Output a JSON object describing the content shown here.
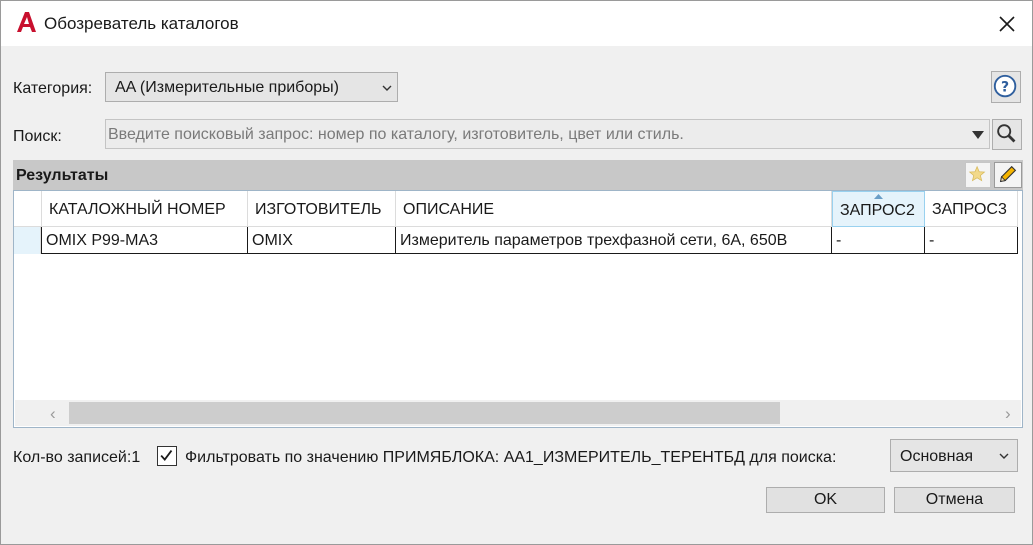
{
  "window": {
    "title": "Обозреватель каталогов",
    "icon": "autocad-logo-icon",
    "close_icon": "close-icon"
  },
  "category": {
    "label": "Категория:",
    "value": "AA (Измерительные приборы)"
  },
  "search": {
    "label": "Поиск:",
    "placeholder": "Введите поисковый запрос: номер по каталогу, изготовитель, цвет или стиль."
  },
  "results": {
    "title": "Результаты",
    "columns": [
      "КАТАЛОЖНЫЙ НОМЕР",
      "ИЗГОТОВИТЕЛЬ",
      "ОПИСАНИЕ",
      "ЗАПРОС2",
      "ЗАПРОС3"
    ],
    "rows": [
      [
        "OMIX P99-MA3",
        "OMIX",
        "Измеритель параметров трехфазной сети, 6А, 650В",
        "-",
        "-"
      ]
    ],
    "sorted_column": "ЗАПРОС2"
  },
  "footer": {
    "record_count_label": "Кол-во записей:1",
    "filter_label": "Фильтровать по значению ПРИМЯБЛОКА: AA1_ИЗМЕРИТЕЛЬ_ТЕРЕНТБД для поиска:",
    "filter_checked": true,
    "database_value": "Основная"
  },
  "buttons": {
    "ok": "OK",
    "cancel": "Отмена"
  },
  "colors": {
    "accent_red": "#c8102e",
    "results_header": "#c8c8c8",
    "selected_header": "#e5f3fb"
  }
}
